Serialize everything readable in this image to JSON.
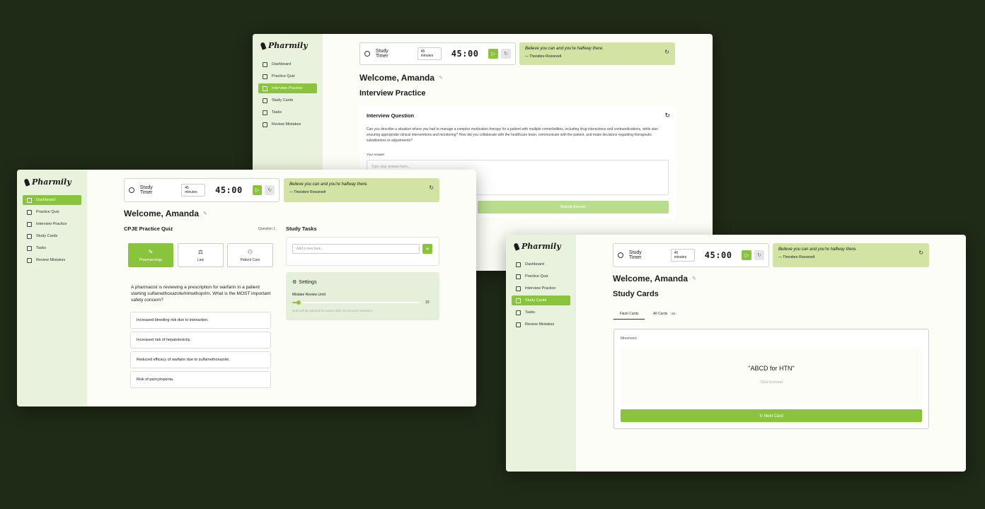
{
  "brand": "Pharmily",
  "nav": [
    "Dashboard",
    "Practice Quiz",
    "Interview Practice",
    "Study Cards",
    "Tasks",
    "Review Mistakes"
  ],
  "timer": {
    "label": "Study Timer",
    "duration": "45 minutes",
    "display": "45:00",
    "play_glyph": "▷",
    "reset_glyph": "↻"
  },
  "quote": {
    "text": "Believe you can and you're halfway there.",
    "author": "— Theodore Roosevelt"
  },
  "welcome": "Welcome,  Amanda",
  "interview": {
    "title": "Interview Practice",
    "card_title": "Interview Question",
    "question": "Can you describe a situation where you had to manage a complex medication therapy for a patient with multiple comorbidities, including drug interactions and contraindications, while also ensuring appropriate clinical interventions and monitoring? How did you collaborate with the healthcare team, communicate with the patient, and make decisions regarding therapeutic substitutions or adjustments?",
    "answer_label": "Your Answer",
    "answer_placeholder": "Type your answer here...",
    "submit": "Submit Answer"
  },
  "quiz": {
    "title": "CPJE Practice Quiz",
    "counter": "Question 1",
    "categories": [
      "Pharmacology",
      "Law",
      "Patient Care"
    ],
    "question": "A pharmacist is reviewing a prescription for warfarin in a patient starting sulfamethoxazole/trimethoprim. What is the MOST important safety concern?",
    "options": [
      "Increased bleeding risk due to interaction.",
      "Increased risk of hepatotoxicity.",
      "Reduced efficacy of warfarin due to sulfamethoxazole.",
      "Risk of pancytopenia."
    ]
  },
  "tasks": {
    "title": "Study Tasks",
    "placeholder": "Add a new task...",
    "add": "+"
  },
  "settings": {
    "title": "Settings",
    "limit_label": "Mistake Review Limit",
    "limit_value": "10",
    "limit_fraction": 0.05,
    "hint": "Quiz will be paused for review after 10 incorrect answers"
  },
  "cards": {
    "title": "Study Cards",
    "tab_flash": "Flash Cards",
    "tab_all": "All Cards",
    "all_count": "99",
    "card_type": "Mnemonic",
    "card_text": "\"ABCD for HTN\"",
    "reveal": "Click to reveal",
    "next": "↻ Next Card"
  },
  "colors": {
    "accent": "#8ac33c",
    "background": "#1f2a17",
    "sidebar": "#e9f2dc",
    "quote": "#d2e3a4"
  }
}
